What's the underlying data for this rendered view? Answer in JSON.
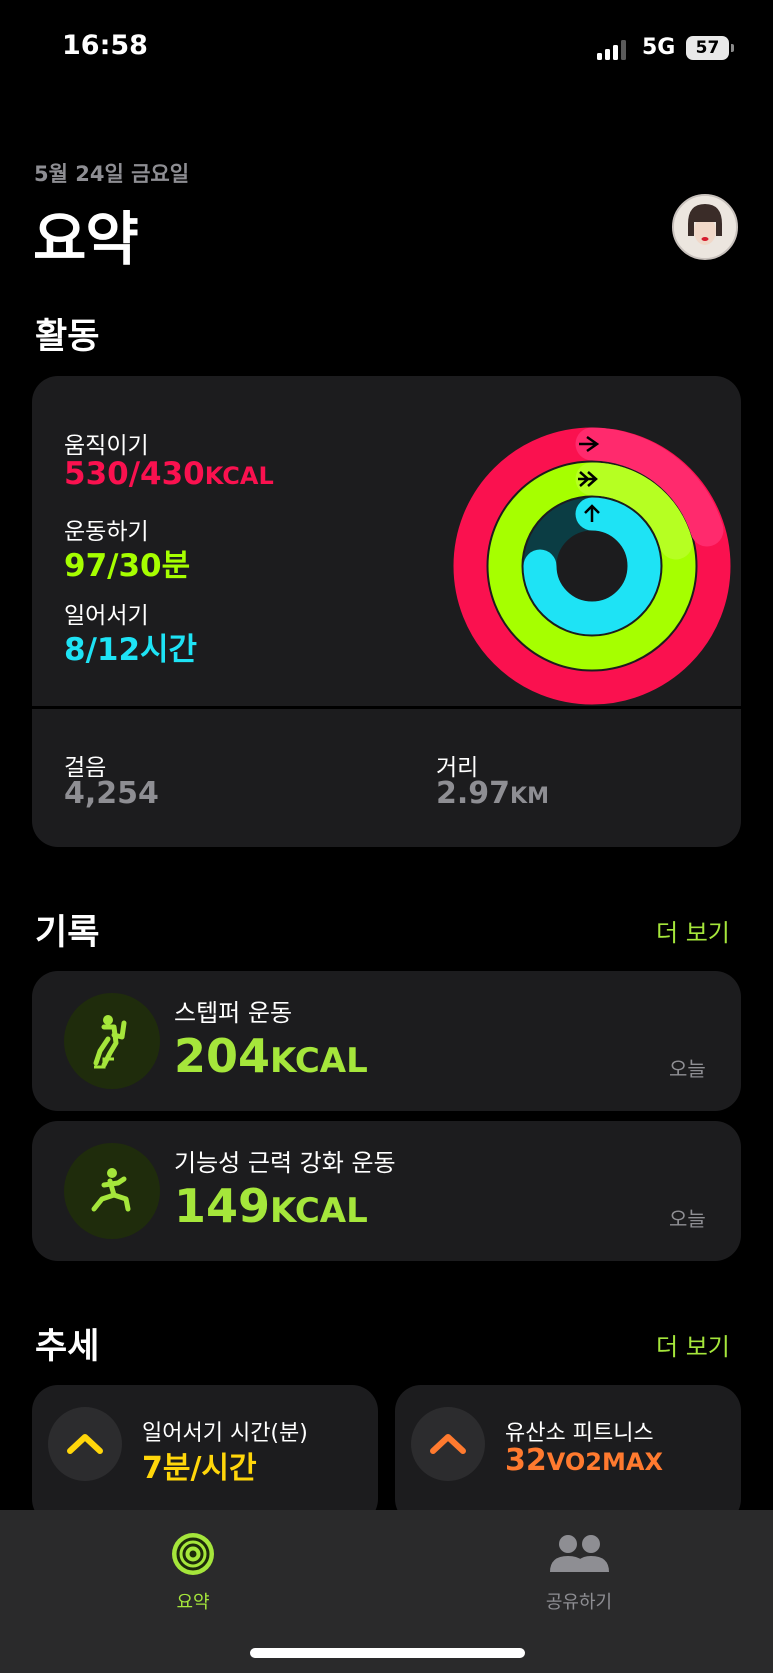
{
  "status_bar": {
    "time": "16:58",
    "network": "5G",
    "battery": "57"
  },
  "header": {
    "date": "5월 24일 금요일",
    "title": "요약"
  },
  "activity": {
    "section_title": "활동",
    "rings": [
      {
        "label": "움직이기",
        "current": "530",
        "goal": "430",
        "unit": "KCAL",
        "color": "#fa114f",
        "progress": 1.23
      },
      {
        "label": "운동하기",
        "current": "97",
        "goal": "30",
        "unit": "분",
        "color": "#a6ff00",
        "progress": 3.23
      },
      {
        "label": "일어서기",
        "current": "8",
        "goal": "12",
        "unit": "시간",
        "color": "#1ee3f5",
        "progress": 0.67
      }
    ],
    "move_value": "530/430",
    "move_unit": "KCAL",
    "exercise_value": "97/30분",
    "stand_value": "8/12시간",
    "steps": {
      "label": "걸음",
      "value": "4,254"
    },
    "distance": {
      "label": "거리",
      "value": "2.97",
      "unit": "KM"
    }
  },
  "records": {
    "section_title": "기록",
    "more_label": "더 보기",
    "items": [
      {
        "name": "스텝퍼 운동",
        "value": "204",
        "unit": "KCAL",
        "date": "오늘",
        "icon": "stair-stepper-icon"
      },
      {
        "name": "기능성 근력 강화 운동",
        "value": "149",
        "unit": "KCAL",
        "date": "오늘",
        "icon": "strength-training-icon"
      }
    ]
  },
  "trends": {
    "section_title": "추세",
    "more_label": "더 보기",
    "items": [
      {
        "name": "일어서기 시간(분)",
        "value": "7분/시간",
        "color": "#ffd60a",
        "icon": "chevron-up-icon"
      },
      {
        "name": "유산소 피트니스",
        "value": "32",
        "unit": "VO2MAX",
        "color": "#ff7a2f",
        "icon": "chevron-up-icon"
      }
    ]
  },
  "tabbar": {
    "tabs": [
      {
        "label": "요약",
        "active": true,
        "color": "#a5e63b"
      },
      {
        "label": "공유하기",
        "active": false,
        "color": "#8e8e93"
      }
    ]
  }
}
